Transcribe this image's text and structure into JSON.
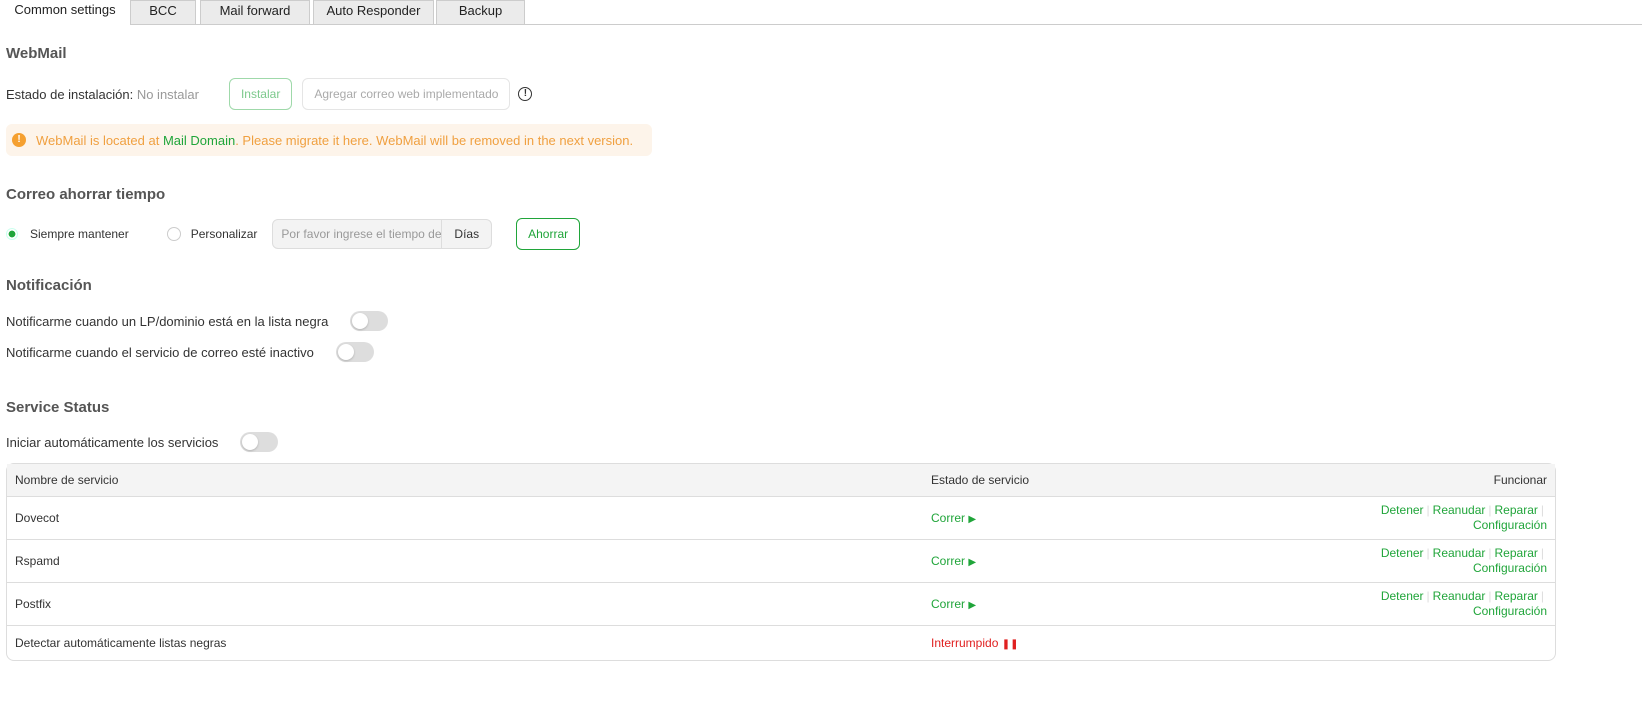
{
  "tabs": [
    "Common settings",
    "BCC",
    "Mail forward",
    "Auto Responder",
    "Backup"
  ],
  "webmail": {
    "title": "WebMail",
    "status_label": "Estado de instalación:",
    "status_value": "No instalar",
    "install": "Instalar",
    "add_deployed": "Agregar correo web implementado",
    "alert_pre": "WebMail is located at ",
    "alert_link": "Mail Domain",
    "alert_post": ". Please migrate it here. WebMail will be removed in the next version."
  },
  "save_time": {
    "title": "Correo ahorrar tiempo",
    "opt1": "Siempre mantener",
    "opt2": "Personalizar",
    "placeholder": "Por favor ingrese el tiempo de",
    "unit": "Días",
    "save": "Ahorrar"
  },
  "notification": {
    "title": "Notificación",
    "blacklist": "Notificarme cuando un LP/dominio está en la lista negra",
    "inactive": "Notificarme cuando el servicio de correo esté inactivo"
  },
  "service": {
    "title": "Service Status",
    "autostart": "Iniciar automáticamente los servicios",
    "headers": [
      "Nombre de servicio",
      "Estado de servicio",
      "Funcionar"
    ],
    "actions": [
      "Detener",
      "Reanudar",
      "Reparar",
      "Configuración"
    ],
    "rows": [
      {
        "name": "Dovecot",
        "status": "Correr"
      },
      {
        "name": "Rspamd",
        "status": "Correr"
      },
      {
        "name": "Postfix",
        "status": "Correr"
      },
      {
        "name": "Detectar automáticamente listas negras",
        "status": "Interrumpido"
      }
    ]
  }
}
